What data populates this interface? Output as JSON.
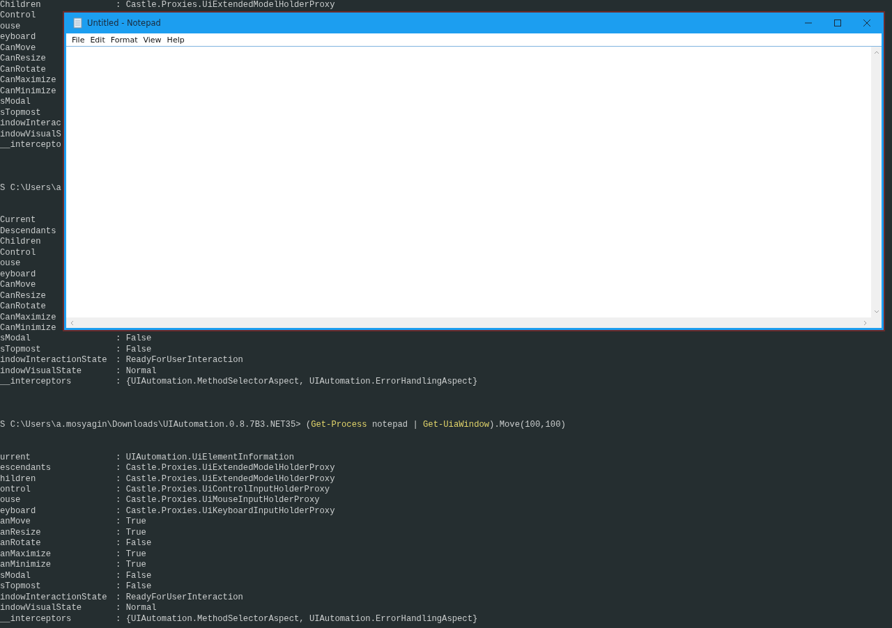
{
  "console": {
    "blocks": [
      {
        "kind": "properties",
        "rows": [
          {
            "key": "Children",
            "value": ": Castle.Proxies.UiExtendedModelHolderProxy"
          },
          {
            "key": "Control"
          },
          {
            "key": "ouse"
          },
          {
            "key": "eyboard"
          },
          {
            "key": "CanMove"
          },
          {
            "key": "CanResize"
          },
          {
            "key": "CanRotate"
          },
          {
            "key": "CanMaximize"
          },
          {
            "key": "CanMinimize"
          },
          {
            "key": "sModal"
          },
          {
            "key": "sTopmost"
          },
          {
            "key": "indowInterac"
          },
          {
            "key": "indowVisualS"
          },
          {
            "key": "__intercepto"
          }
        ]
      },
      {
        "kind": "prompt",
        "path": "S C:\\Users\\a"
      },
      {
        "kind": "properties",
        "rows": [
          {
            "key": "Current"
          },
          {
            "key": "Descendants"
          },
          {
            "key": "Children"
          },
          {
            "key": "Control"
          },
          {
            "key": "ouse"
          },
          {
            "key": "eyboard"
          },
          {
            "key": "CanMove"
          },
          {
            "key": "CanResize"
          },
          {
            "key": "CanRotate"
          },
          {
            "key": "CanMaximize"
          },
          {
            "key": "CanMinimize"
          },
          {
            "key": "sModal",
            "value": ": False"
          },
          {
            "key": "sTopmost",
            "value": ": False"
          },
          {
            "key": "indowInteractionState",
            "value": ": ReadyForUserInteraction"
          },
          {
            "key": "indowVisualState",
            "value": ": Normal"
          },
          {
            "key": "__interceptors",
            "value": ": {UIAutomation.MethodSelectorAspect, UIAutomation.ErrorHandlingAspect}"
          }
        ]
      },
      {
        "kind": "prompt",
        "path": "S C:\\Users\\a.mosyagin\\Downloads\\UIAutomation.0.8.7B3.NET35>",
        "tokens": [
          {
            "text": "(",
            "kind": "plain"
          },
          {
            "text": "Get-Process",
            "kind": "command",
            "space_after": true
          },
          {
            "text": "notepad |",
            "kind": "plain",
            "space_after": true
          },
          {
            "text": "Get-UiaWindow",
            "kind": "command",
            "space_after": false
          },
          {
            "text": ").Move(100,100)",
            "kind": "plain"
          }
        ]
      },
      {
        "kind": "properties",
        "rows": [
          {
            "key": "urrent",
            "value": ": UIAutomation.UiElementInformation"
          },
          {
            "key": "escendants",
            "value": ": Castle.Proxies.UiExtendedModelHolderProxy"
          },
          {
            "key": "hildren",
            "value": ": Castle.Proxies.UiExtendedModelHolderProxy"
          },
          {
            "key": "ontrol",
            "value": ": Castle.Proxies.UiControlInputHolderProxy"
          },
          {
            "key": "ouse",
            "value": ": Castle.Proxies.UiMouseInputHolderProxy"
          },
          {
            "key": "eyboard",
            "value": ": Castle.Proxies.UiKeyboardInputHolderProxy"
          },
          {
            "key": "anMove",
            "value": ": True"
          },
          {
            "key": "anResize",
            "value": ": True"
          },
          {
            "key": "anRotate",
            "value": ": False"
          },
          {
            "key": "anMaximize",
            "value": ": True"
          },
          {
            "key": "anMinimize",
            "value": ": True"
          },
          {
            "key": "sModal",
            "value": ": False"
          },
          {
            "key": "sTopmost",
            "value": ": False"
          },
          {
            "key": "indowInteractionState",
            "value": ": ReadyForUserInteraction"
          },
          {
            "key": "indowVisualState",
            "value": ": Normal"
          },
          {
            "key": "__interceptors",
            "value": ": {UIAutomation.MethodSelectorAspect, UIAutomation.ErrorHandlingAspect}"
          }
        ]
      }
    ]
  },
  "notepad": {
    "title": "Untitled - Notepad",
    "menu": [
      "File",
      "Edit",
      "Format",
      "View",
      "Help"
    ]
  }
}
